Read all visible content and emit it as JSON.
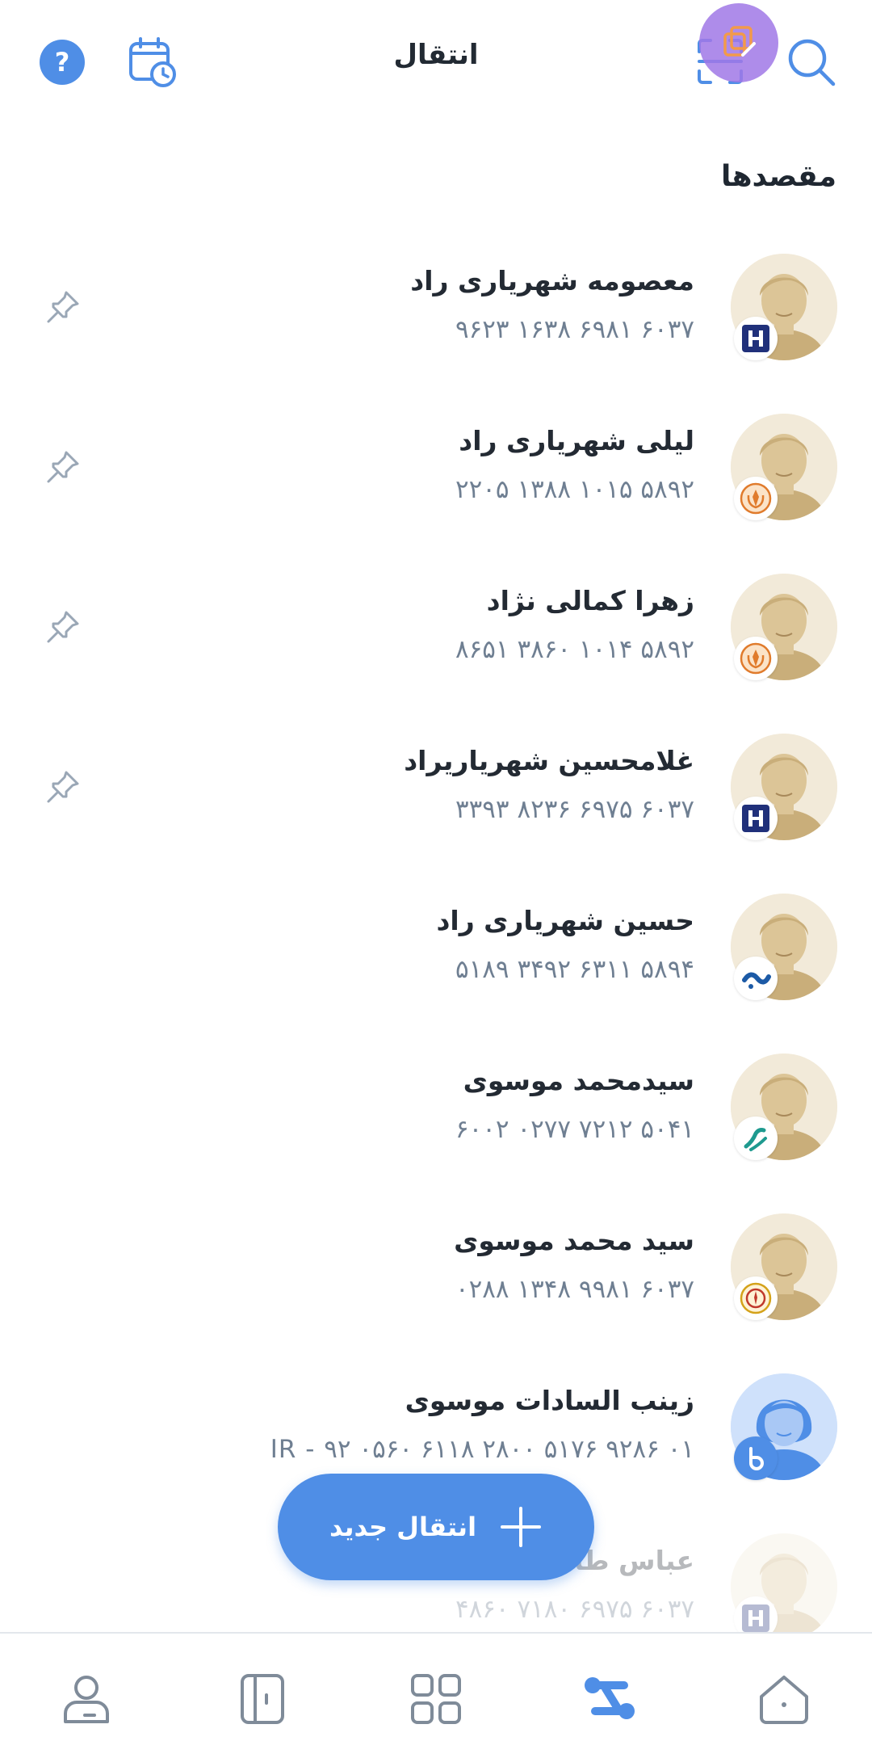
{
  "header": {
    "title": "انتقال",
    "icons": {
      "help": "help-icon",
      "schedule": "calendar-clock-icon",
      "scan": "qr-scan-icon",
      "search": "search-icon"
    }
  },
  "section_title": "مقصدها",
  "contacts": [
    {
      "name": "معصومه شهریاری راد",
      "number": "۶۰۳۷ ۶۹۸۱ ۱۶۳۸ ۹۶۲۳",
      "bank": "saderat",
      "pinned_icon": "pin-icon"
    },
    {
      "name": "لیلی شهریاری راد",
      "number": "۵۸۹۲ ۱۰۱۵ ۱۳۸۸ ۲۲۰۵",
      "bank": "sepah",
      "pinned_icon": "pin-icon"
    },
    {
      "name": "زهرا کمالی نژاد",
      "number": "۵۸۹۲ ۱۰۱۴ ۳۸۶۰ ۸۶۵۱",
      "bank": "sepah",
      "pinned_icon": "pin-icon"
    },
    {
      "name": "غلامحسین شهریاریراد",
      "number": "۶۰۳۷ ۶۹۷۵ ۸۲۳۶ ۳۳۹۳",
      "bank": "saderat",
      "pinned_icon": "pin-icon"
    },
    {
      "name": "حسین شهریاری راد",
      "number": "۵۸۹۴ ۶۳۱۱ ۳۴۹۲ ۵۱۸۹",
      "bank": "refah"
    },
    {
      "name": "سیدمحمد موسوی",
      "number": "۵۰۴۱ ۷۲۱۲ ۰۲۷۷ ۶۰۰۲",
      "bank": "resalat"
    },
    {
      "name": "سید محمد موسوی",
      "number": "۶۰۳۷ ۹۹۸۱ ۱۳۴۸ ۰۲۸۸",
      "bank": "melli"
    },
    {
      "name": "زینب السادات موسوی",
      "number": "IR - ۹۲ ۰۵۶۰ ۶۱۱۸ ۲۸۰۰ ۵۱۷۶ ۹۲۸۶ ۰۱",
      "bank": "blu"
    },
    {
      "name": "عباس طاهری",
      "number": "۶۰۳۷ ۶۹۷۵ ۷۱۸۰ ۴۸۶۰",
      "bank": "saderat"
    }
  ],
  "fab": {
    "label": "انتقال جدید",
    "icon": "plus-icon"
  },
  "bottom_nav": [
    {
      "name": "profile",
      "icon": "user-icon"
    },
    {
      "name": "cards",
      "icon": "card-book-icon"
    },
    {
      "name": "services",
      "icon": "grid-icon"
    },
    {
      "name": "transfer",
      "icon": "transfer-icon",
      "active": true
    },
    {
      "name": "home",
      "icon": "home-icon"
    }
  ],
  "colors": {
    "accent": "#4f8ee6",
    "text_primary": "#232a33",
    "text_secondary": "#6f7f92",
    "icon_muted": "#9aa7b6",
    "avatar_bg": "#f2ead9"
  }
}
